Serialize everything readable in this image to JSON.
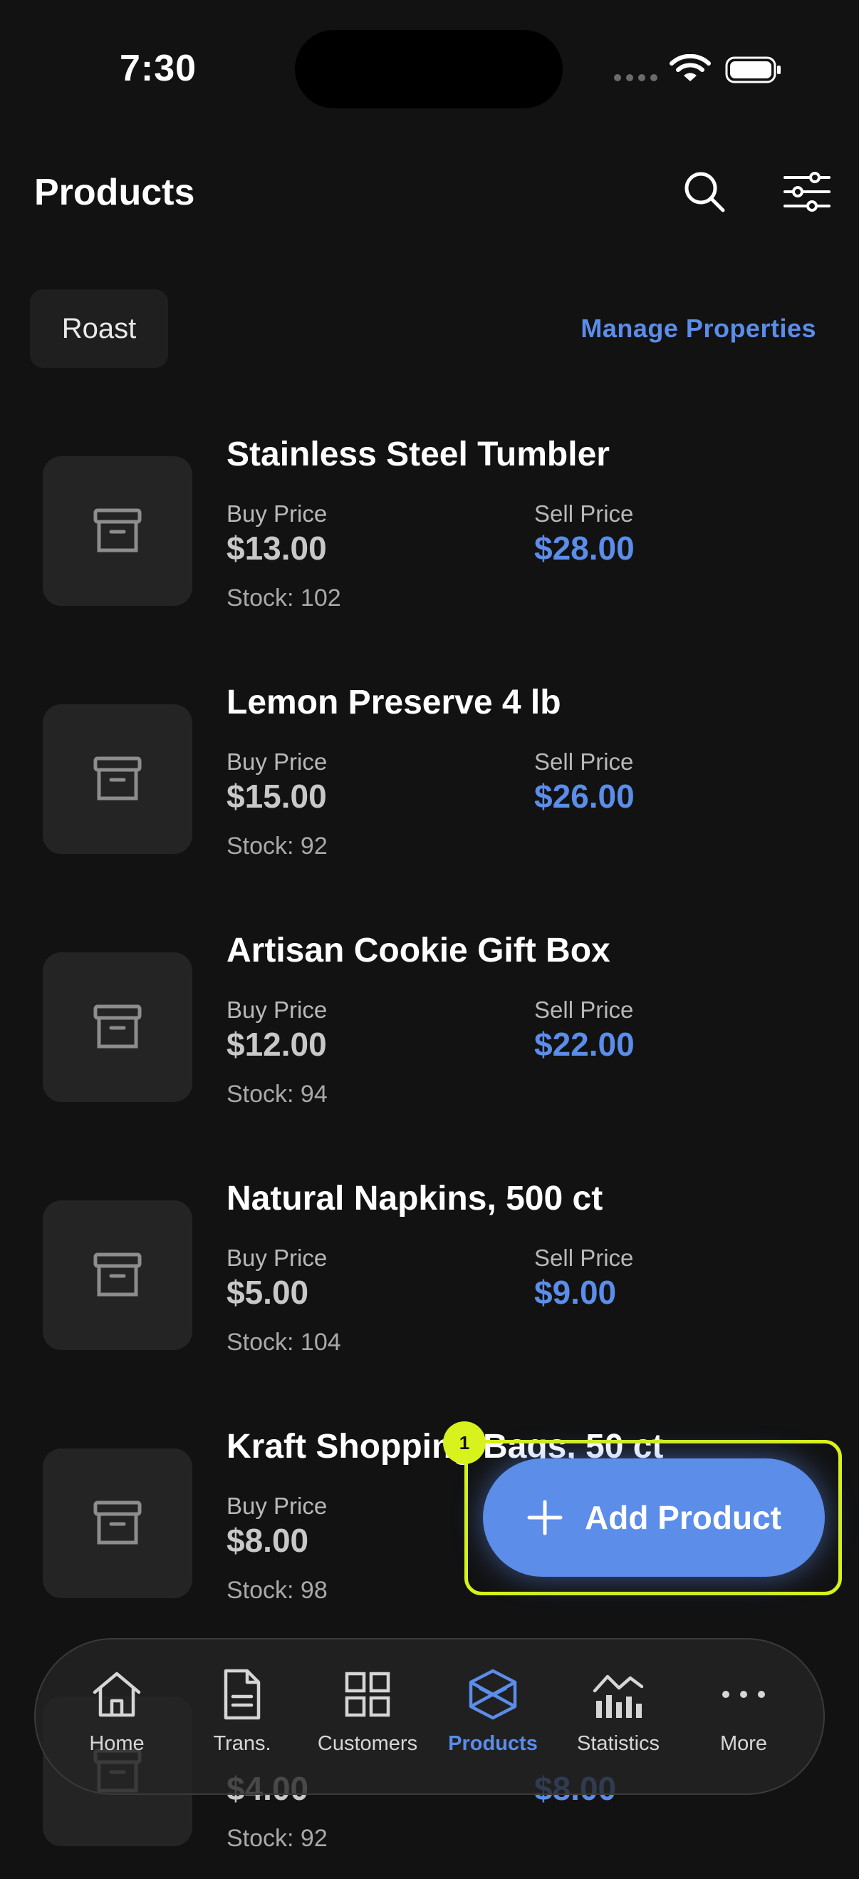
{
  "status": {
    "time": "7:30"
  },
  "header": {
    "title": "Products",
    "search_icon": "search-icon",
    "filter_icon": "sliders-icon"
  },
  "filter_chip": "Roast",
  "manage_properties": "Manage Properties",
  "labels": {
    "buy": "Buy Price",
    "sell": "Sell Price"
  },
  "products": [
    {
      "name": "Stainless Steel Tumbler",
      "buy": "$13.00",
      "sell": "$28.00",
      "stock": "Stock: 102"
    },
    {
      "name": "Lemon Preserve 4 lb",
      "buy": "$15.00",
      "sell": "$26.00",
      "stock": "Stock: 92"
    },
    {
      "name": "Artisan Cookie Gift Box",
      "buy": "$12.00",
      "sell": "$22.00",
      "stock": "Stock: 94"
    },
    {
      "name": "Natural Napkins, 500 ct",
      "buy": "$5.00",
      "sell": "$9.00",
      "stock": "Stock: 104"
    },
    {
      "name": "Kraft Shopping Bags, 50 ct",
      "buy": "$8.00",
      "sell": "",
      "stock": "Stock: 98"
    },
    {
      "name": "",
      "buy": "$4.00",
      "sell": "$8.00",
      "stock": "Stock: 92"
    }
  ],
  "fab": {
    "label": "Add Product",
    "badge": "1"
  },
  "nav": [
    {
      "label": "Home",
      "icon": "home-icon"
    },
    {
      "label": "Trans.",
      "icon": "document-icon"
    },
    {
      "label": "Customers",
      "icon": "grid-icon"
    },
    {
      "label": "Products",
      "icon": "cube-icon",
      "active": true
    },
    {
      "label": "Statistics",
      "icon": "bar-chart-icon"
    },
    {
      "label": "More",
      "icon": "more-icon"
    }
  ],
  "colors": {
    "accent": "#5b8de9",
    "highlight": "#d7f21c",
    "background": "#121213"
  }
}
